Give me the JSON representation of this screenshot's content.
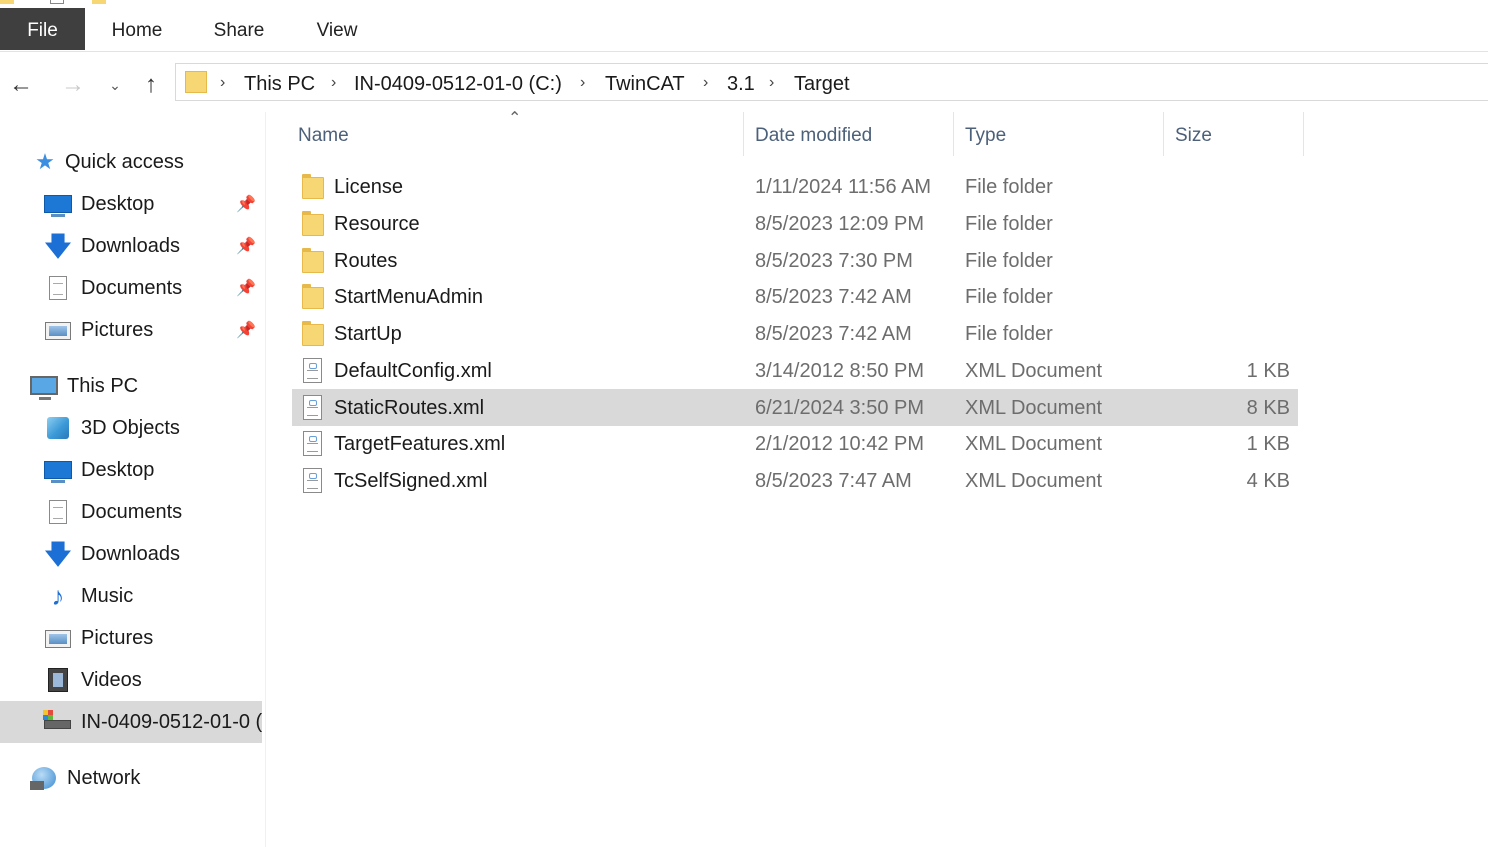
{
  "ribbon": {
    "tabs": [
      {
        "label": "File",
        "active": true
      },
      {
        "label": "Home"
      },
      {
        "label": "Share"
      },
      {
        "label": "View"
      }
    ]
  },
  "nav": {
    "back_icon": "arrow-left",
    "forward_icon": "arrow-right",
    "recent_icon": "chevron-down",
    "up_icon": "arrow-up"
  },
  "address": {
    "crumbs": [
      "This PC",
      "IN-0409-0512-01-0 (C:)",
      "TwinCAT",
      "3.1",
      "Target"
    ]
  },
  "navpane": {
    "quick_access": "Quick access",
    "quick_items": [
      "Desktop",
      "Downloads",
      "Documents",
      "Pictures"
    ],
    "this_pc": "This PC",
    "pc_items": [
      "3D Objects",
      "Desktop",
      "Documents",
      "Downloads",
      "Music",
      "Pictures",
      "Videos",
      "IN-0409-0512-01-0 ("
    ],
    "network": "Network"
  },
  "columns": {
    "name": "Name",
    "date": "Date modified",
    "type": "Type",
    "size": "Size"
  },
  "files": [
    {
      "name": "License",
      "date": "1/11/2024 11:56 AM",
      "type": "File folder",
      "size": "",
      "kind": "folder"
    },
    {
      "name": "Resource",
      "date": "8/5/2023 12:09 PM",
      "type": "File folder",
      "size": "",
      "kind": "folder"
    },
    {
      "name": "Routes",
      "date": "8/5/2023 7:30 PM",
      "type": "File folder",
      "size": "",
      "kind": "folder"
    },
    {
      "name": "StartMenuAdmin",
      "date": "8/5/2023 7:42 AM",
      "type": "File folder",
      "size": "",
      "kind": "folder"
    },
    {
      "name": "StartUp",
      "date": "8/5/2023 7:42 AM",
      "type": "File folder",
      "size": "",
      "kind": "folder"
    },
    {
      "name": "DefaultConfig.xml",
      "date": "3/14/2012 8:50 PM",
      "type": "XML Document",
      "size": "1 KB",
      "kind": "xml"
    },
    {
      "name": "StaticRoutes.xml",
      "date": "6/21/2024 3:50 PM",
      "type": "XML Document",
      "size": "8 KB",
      "kind": "xml",
      "selected": true
    },
    {
      "name": "TargetFeatures.xml",
      "date": "2/1/2012 10:42 PM",
      "type": "XML Document",
      "size": "1 KB",
      "kind": "xml"
    },
    {
      "name": "TcSelfSigned.xml",
      "date": "8/5/2023 7:47 AM",
      "type": "XML Document",
      "size": "4 KB",
      "kind": "xml"
    }
  ]
}
